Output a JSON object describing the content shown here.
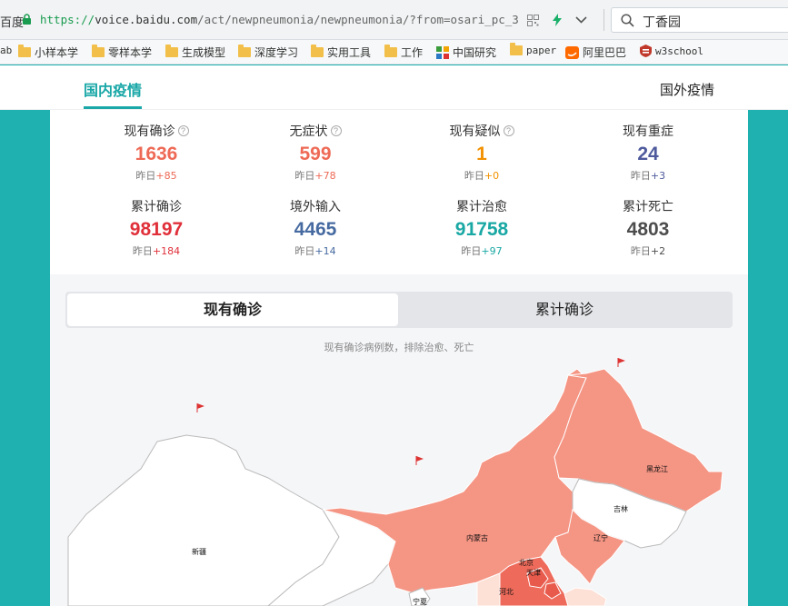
{
  "browser": {
    "site_label": "百度",
    "url_scheme": "https://",
    "url_domain": "voice.baidu.com",
    "url_path": "/act/newpneumonia/newpneumonia/?from=osari_pc_3",
    "search_query": "丁香园"
  },
  "bookmarks": [
    {
      "label": "ab",
      "icon": "none"
    },
    {
      "label": "小样本学",
      "icon": "folder-icon"
    },
    {
      "label": "零样本学",
      "icon": "folder-icon"
    },
    {
      "label": "生成模型",
      "icon": "folder-icon"
    },
    {
      "label": "深度学习",
      "icon": "folder-icon"
    },
    {
      "label": "实用工具",
      "icon": "folder-icon"
    },
    {
      "label": "工作",
      "icon": "folder-icon"
    },
    {
      "label": "中国研究",
      "icon": "cnki-icon"
    },
    {
      "label": "paper",
      "icon": "folder-icon"
    },
    {
      "label": "阿里巴巴",
      "icon": "alibaba-icon"
    },
    {
      "label": "w3school",
      "icon": "w3school-icon"
    }
  ],
  "tabs": {
    "domestic": "国内疫情",
    "foreign": "国外疫情"
  },
  "stats": [
    {
      "label": "现有确诊",
      "value": "1636",
      "delta_prefix": "昨日",
      "delta": "+85",
      "color": "#ee6a56",
      "has_help": true
    },
    {
      "label": "无症状",
      "value": "599",
      "delta_prefix": "昨日",
      "delta": "+78",
      "color": "#ee6a56",
      "has_help": true
    },
    {
      "label": "现有疑似",
      "value": "1",
      "delta_prefix": "昨日",
      "delta": "+0",
      "color": "#f29100",
      "has_help": true
    },
    {
      "label": "现有重症",
      "value": "24",
      "delta_prefix": "昨日",
      "delta": "+3",
      "color": "#4e5a9c",
      "has_help": false
    },
    {
      "label": "累计确诊",
      "value": "98197",
      "delta_prefix": "昨日",
      "delta": "+184",
      "color": "#e0303a",
      "has_help": false
    },
    {
      "label": "境外输入",
      "value": "4465",
      "delta_prefix": "昨日",
      "delta": "+14",
      "color": "#476ba1",
      "has_help": false
    },
    {
      "label": "累计治愈",
      "value": "91758",
      "delta_prefix": "昨日",
      "delta": "+97",
      "color": "#1aa8a4",
      "has_help": false
    },
    {
      "label": "累计死亡",
      "value": "4803",
      "delta_prefix": "昨日",
      "delta": "+2",
      "color": "#4d4d4d",
      "has_help": false
    }
  ],
  "switcher": {
    "current": "现有确诊",
    "total": "累计确诊"
  },
  "map": {
    "caption": "现有确诊病例数，排除治愈、死亡",
    "provinces": {
      "heilongjiang": "黑龙江",
      "jilin": "吉林",
      "liaoning": "辽宁",
      "neimenggu": "内蒙古",
      "xinjiang": "新疆",
      "beijing": "北京",
      "tianjin": "天津",
      "hebei": "河北",
      "ningxia": "宁夏"
    },
    "colors": {
      "high": "#f59584",
      "higher": "#ee6a5a",
      "low": "#fde0d6",
      "none": "#ffffff",
      "border": "#bbbbbb"
    }
  }
}
